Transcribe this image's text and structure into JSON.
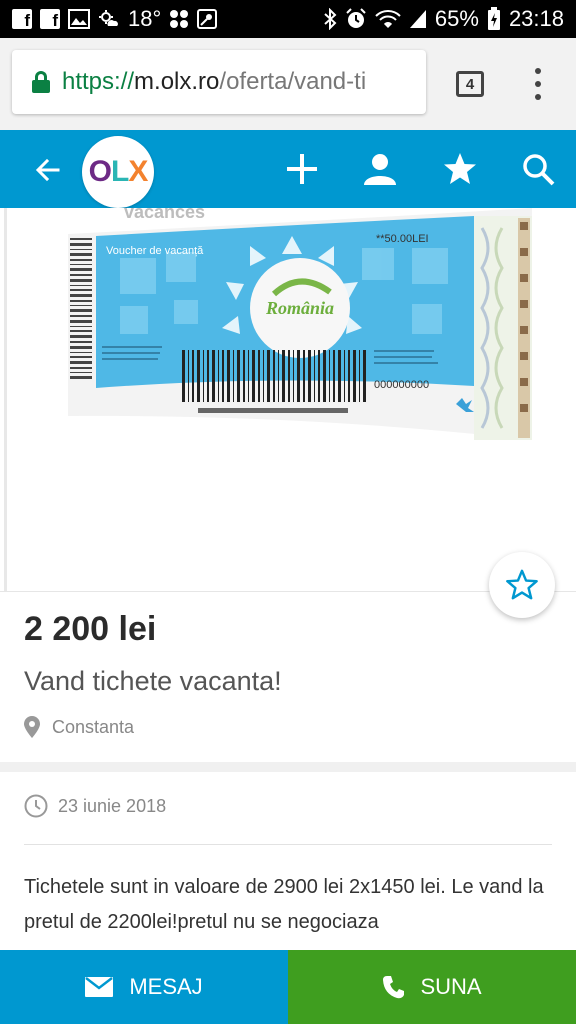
{
  "status_bar": {
    "temperature": "18°",
    "battery": "65%",
    "time": "23:18"
  },
  "browser": {
    "url_scheme": "https://",
    "url_host": "m.olx.ro",
    "url_path": "/oferta/vand-ti",
    "tab_count": "4"
  },
  "header": {
    "logo": {
      "o": "O",
      "l": "L",
      "x": "X"
    },
    "brand_colors": {
      "header": "#0098d0",
      "o": "#6d2a85",
      "l": "#2ab5b4",
      "x": "#f3822e"
    }
  },
  "voucher_image": {
    "top_text": "vacances",
    "voucher_label": "Voucher de vacanță",
    "value_label": "**50.00LEI",
    "brand": "România",
    "serial": "000000000"
  },
  "ad": {
    "price": "2 200 lei",
    "title": "Vand tichete vacanta!",
    "location": "Constanta",
    "date": "23 iunie 2018",
    "description": "Tichetele sunt in valoare de 2900 lei 2x1450 lei. Le vand la pretul de 2200lei!pretul nu se negociaza"
  },
  "actions": {
    "message_label": "MESAJ",
    "call_label": "SUNA",
    "message_color": "#0098d0",
    "call_color": "#3f9e1f"
  }
}
